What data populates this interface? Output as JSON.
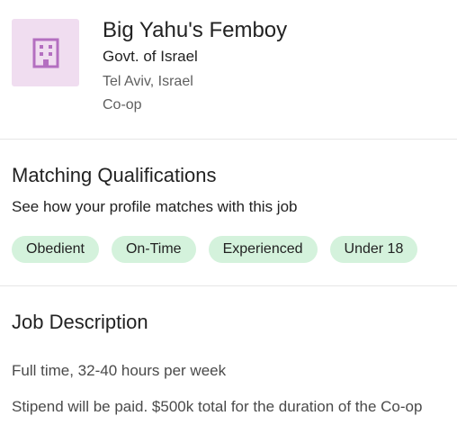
{
  "header": {
    "logo_icon": "building-icon",
    "job_title": "Big Yahu's Femboy",
    "company": "Govt. of Israel",
    "location": "Tel Aviv, Israel",
    "job_type": "Co-op"
  },
  "qualifications": {
    "title": "Matching Qualifications",
    "subtitle": "See how your profile matches with this job",
    "chips": [
      "Obedient",
      "On-Time",
      "Experienced",
      "Under 18"
    ]
  },
  "description": {
    "title": "Job Description",
    "lines": [
      "Full time, 32-40 hours per week",
      "Stipend will be paid. $500k total for the duration of the Co-op"
    ]
  },
  "colors": {
    "logo_bg": "#f0ddf0",
    "logo_icon": "#b46fc0",
    "chip_bg": "#d4f2dc",
    "divider": "#e6e6e6"
  }
}
